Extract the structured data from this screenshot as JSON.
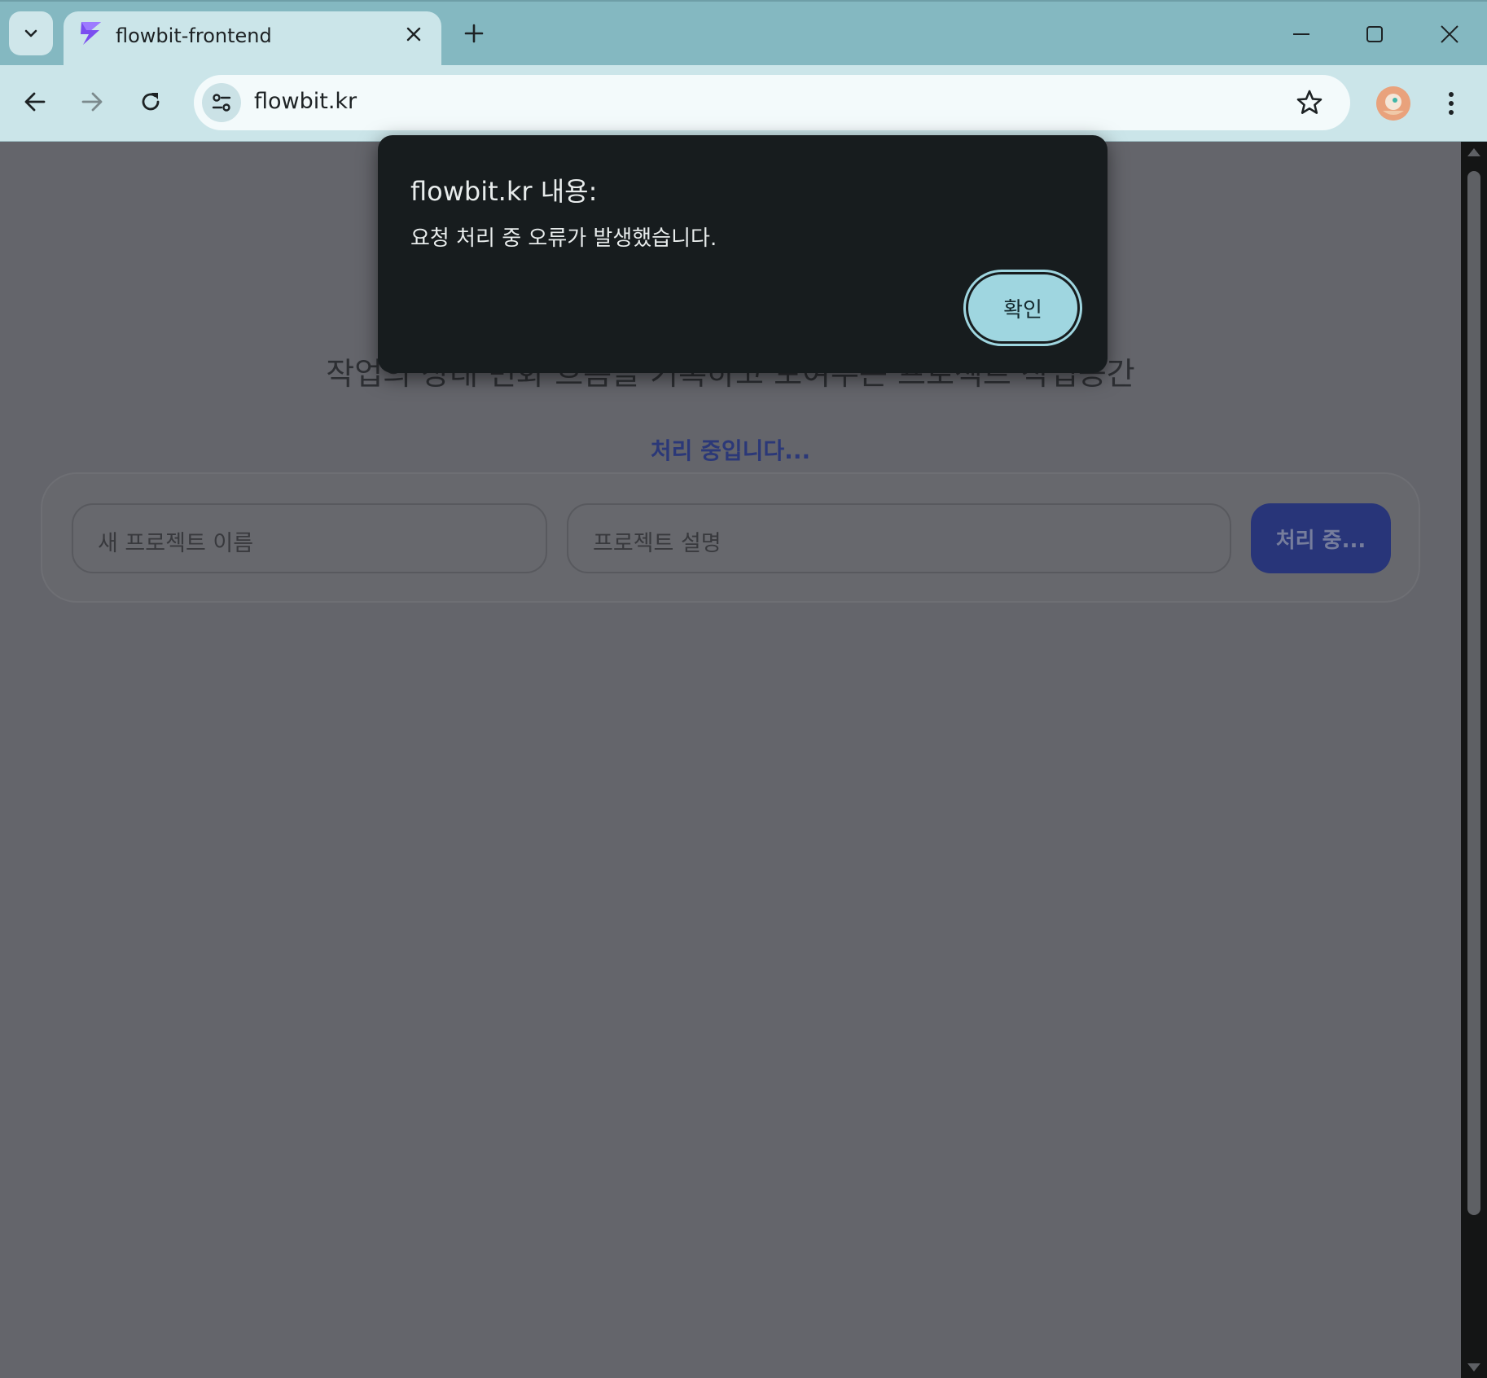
{
  "browser": {
    "tab_title": "flowbit-frontend",
    "url": "flowbit.kr"
  },
  "page": {
    "subtitle": "작업의 상태 변화 흐름을 기록하고 보여주는 프로젝트 작업공간",
    "status": "처리 중입니다...",
    "form": {
      "name_placeholder": "새 프로젝트 이름",
      "description_placeholder": "프로젝트 설명",
      "submit_label": "처리 중..."
    }
  },
  "dialog": {
    "title": "flowbit.kr 내용:",
    "message": "요청 처리 중 오류가 발생했습니다.",
    "ok_label": "확인"
  },
  "colors": {
    "tabstrip": "#84b8c1",
    "toolbar": "#cbe5e9",
    "dialog_bg": "#171c1e",
    "dialog_button": "#9fd6e0",
    "primary": "#283579"
  }
}
